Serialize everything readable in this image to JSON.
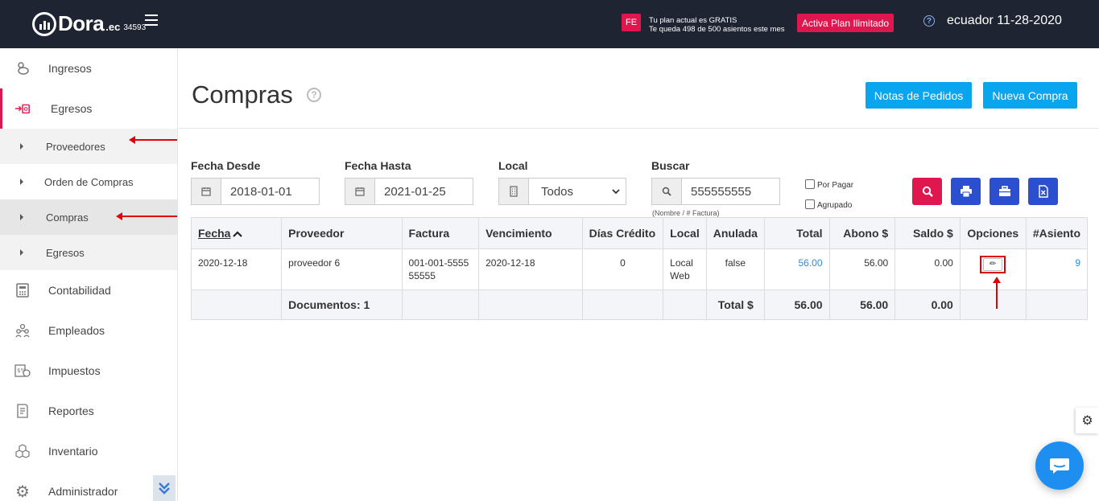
{
  "header": {
    "logo_text": "Dora",
    "logo_ec": ".ec",
    "logo_number": "34593",
    "fe_badge": "FE",
    "plan_line1": "Tu plan actual es GRATIS",
    "plan_line2": "Te queda 498 de 500 asientos este mes",
    "plan_button": "Activa Plan Ilimitado",
    "help_icon": "?",
    "user_info": "ecuador 11-28-2020"
  },
  "sidebar": {
    "items": [
      {
        "label": "Ingresos",
        "icon": "piggy-bank-icon"
      },
      {
        "label": "Egresos",
        "icon": "money-out-icon"
      },
      {
        "label": "Contabilidad",
        "icon": "calculator-icon"
      },
      {
        "label": "Empleados",
        "icon": "people-icon"
      },
      {
        "label": "Impuestos",
        "icon": "tax-icon"
      },
      {
        "label": "Reportes",
        "icon": "report-icon"
      },
      {
        "label": "Inventario",
        "icon": "boxes-icon"
      },
      {
        "label": "Administrador",
        "icon": "gear-icon"
      }
    ],
    "submenu": [
      "Proveedores",
      "Orden de Compras",
      "Compras",
      "Egresos"
    ]
  },
  "main": {
    "title": "Compras",
    "help_icon": "?",
    "btn_notas": "Notas de Pedidos",
    "btn_nueva": "Nueva Compra"
  },
  "filters": {
    "fecha_desde_label": "Fecha Desde",
    "fecha_desde_value": "2018-01-01",
    "fecha_hasta_label": "Fecha Hasta",
    "fecha_hasta_value": "2021-01-25",
    "local_label": "Local",
    "local_value": "Todos",
    "buscar_label": "Buscar",
    "buscar_value": "555555555",
    "buscar_hint": "(Nombre / # Factura)",
    "por_pagar": "Por Pagar",
    "agrupado": "Agrupado"
  },
  "table": {
    "headers": [
      "Fecha",
      "Proveedor",
      "Factura",
      "Vencimiento",
      "Días Crédito",
      "Local",
      "Anulada",
      "Total",
      "Abono $",
      "Saldo $",
      "Opciones",
      "#Asiento"
    ],
    "row": {
      "fecha": "2020-12-18",
      "proveedor": "proveedor 6",
      "factura": "001-001-555555555",
      "vencimiento": "2020-12-18",
      "dias": "0",
      "local": "Local Web",
      "anulada": "false",
      "total": "56.00",
      "abono": "56.00",
      "saldo": "0.00",
      "asiento": "9"
    },
    "footer": {
      "documentos": "Documentos: 1",
      "total_label": "Total $",
      "total": "56.00",
      "abono": "56.00",
      "saldo": "0.00"
    }
  },
  "colors": {
    "topbar": "#1f2433",
    "accent_red": "#e0174f",
    "accent_blue": "#09a5ef",
    "print_blue": "#2b4fcf"
  }
}
